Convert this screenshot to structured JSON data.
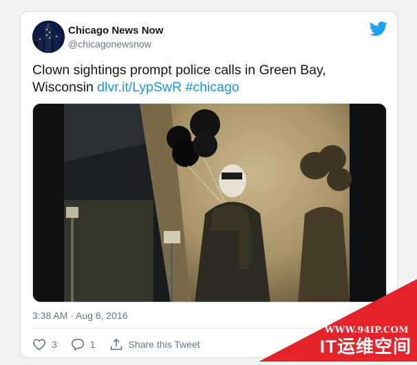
{
  "tweet": {
    "author_name": "Chicago News Now",
    "author_handle": "@chicagonewsnow",
    "text_main": "Clown sightings prompt police calls in Green Bay, Wisconsin ",
    "link_url": "dlvr.it/LypSwR",
    "hashtag": "#chicago",
    "timestamp": "3:38 AM · Aug 6, 2016",
    "likes": "3",
    "replies": "1",
    "share_label": "Share this Tweet"
  },
  "watermark": {
    "url": "WWW.94IP.COM",
    "text": "IT运维空间"
  },
  "colors": {
    "link": "#1b95e0",
    "twitter_blue": "#1da1f2",
    "watermark_red": "#e4232a"
  },
  "icons": {
    "brand": "twitter-bird-icon",
    "like": "heart-icon",
    "reply": "reply-bubble-icon",
    "share": "share-icon"
  }
}
